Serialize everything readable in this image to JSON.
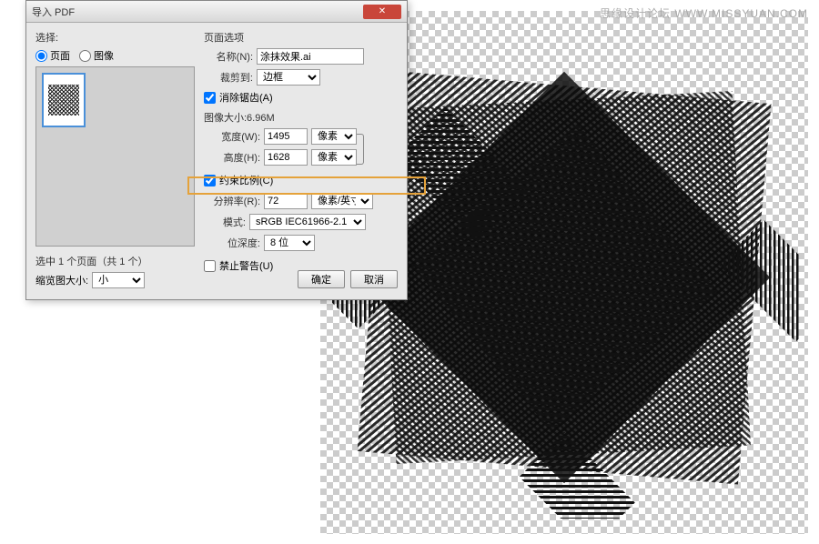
{
  "watermark": "思缘设计论坛  WWW.MISSYUAN.COM",
  "dialog": {
    "title": "导入 PDF",
    "select_label": "选择:",
    "radio_page": "页面",
    "radio_image": "图像",
    "selected_info": "选中 1 个页面（共 1 个）",
    "thumb_size_label": "缩览图大小:",
    "thumb_size_value": "小",
    "ok": "确定",
    "cancel": "取消"
  },
  "page_options": {
    "header": "页面选项",
    "name_label": "名称(N):",
    "name_value": "涂抹效果.ai",
    "crop_label": "裁剪到:",
    "crop_value": "边框",
    "antialias": "消除锯齿(A)",
    "size_label": "图像大小:6.96M",
    "width_label": "宽度(W):",
    "width_value": "1495",
    "height_label": "高度(H):",
    "height_value": "1628",
    "unit_px": "像素",
    "constrain": "约束比例(C)",
    "res_label": "分辨率(R):",
    "res_value": "72",
    "res_unit": "像素/英寸",
    "mode_label": "模式:",
    "mode_value": "sRGB IEC61966-2.1",
    "depth_label": "位深度:",
    "depth_value": "8 位",
    "suppress": "禁止警告(U)"
  }
}
